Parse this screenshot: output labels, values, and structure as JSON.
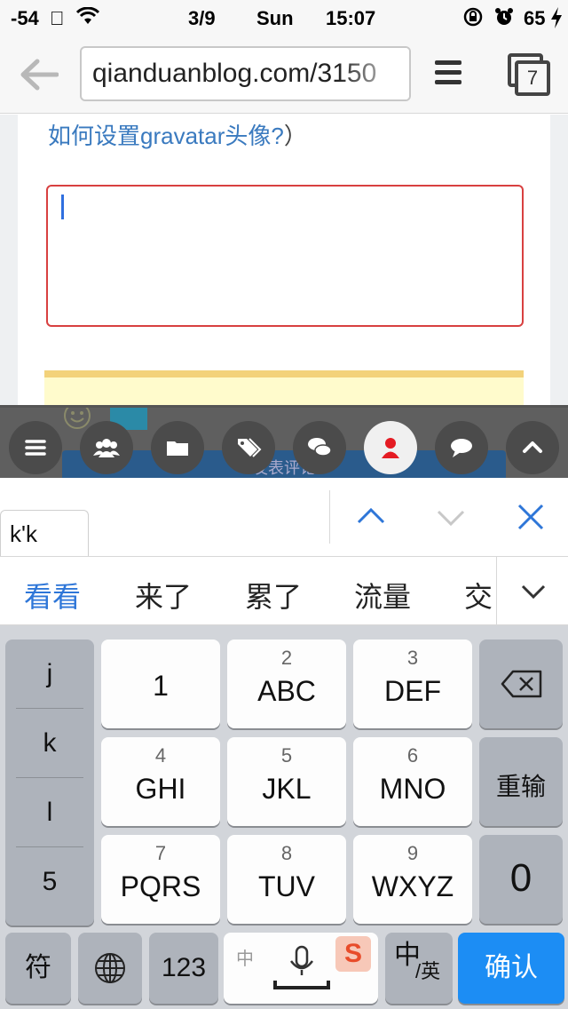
{
  "status_bar": {
    "signal": "-54",
    "page_indicator": "3/9",
    "day": "Sun",
    "time": "15:07",
    "battery": "65"
  },
  "browser": {
    "url": "qianduanblog.com/3150",
    "tab_count": "7"
  },
  "page": {
    "gravatar_link": "如何设置gravatar头像?",
    "link_paren": "）",
    "comment_value": "",
    "hidden_button_label": "发表评论"
  },
  "toolbar": {
    "buttons": [
      "menu",
      "users",
      "folder",
      "tags",
      "comments",
      "user",
      "chat",
      "up"
    ],
    "active": "user"
  },
  "ime": {
    "pinyin": "k'k",
    "candidates": [
      "看看",
      "来了",
      "累了",
      "流量",
      "交"
    ],
    "colors": {
      "accent": "#2e76d8",
      "confirm": "#1c8df4"
    }
  },
  "keyboard": {
    "left_column": [
      "j",
      "k",
      "l",
      "5"
    ],
    "keys": [
      {
        "num": "",
        "letters": "1"
      },
      {
        "num": "2",
        "letters": "ABC"
      },
      {
        "num": "3",
        "letters": "DEF"
      },
      {
        "num": "4",
        "letters": "GHI"
      },
      {
        "num": "5",
        "letters": "JKL"
      },
      {
        "num": "6",
        "letters": "MNO"
      },
      {
        "num": "7",
        "letters": "PQRS"
      },
      {
        "num": "8",
        "letters": "TUV"
      },
      {
        "num": "9",
        "letters": "WXYZ"
      }
    ],
    "reenter": "重输",
    "zero": "0",
    "symbols": "符",
    "numbers": "123",
    "space_label": "中",
    "lang_primary": "中",
    "lang_secondary": "/英",
    "confirm": "确认"
  }
}
